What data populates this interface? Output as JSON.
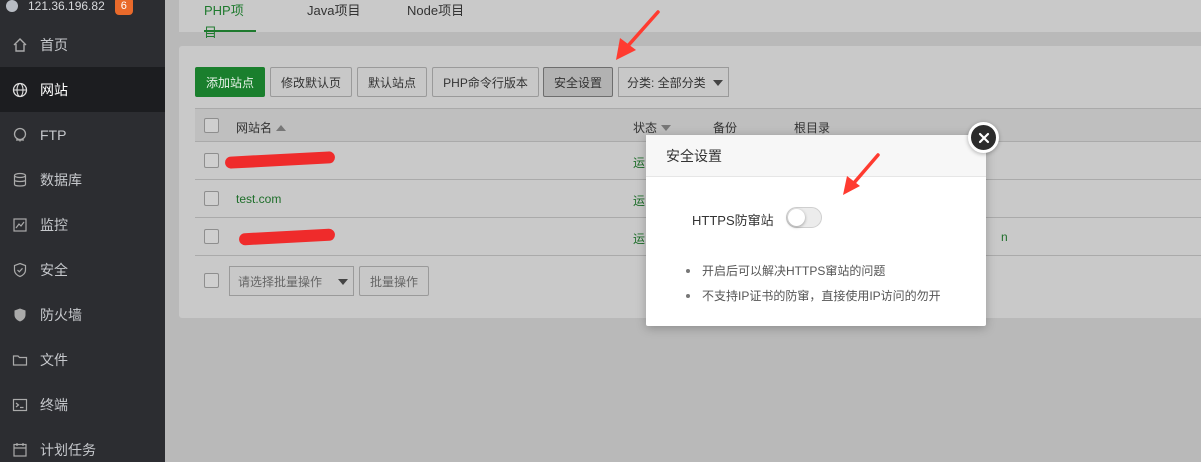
{
  "sidebar": {
    "host": "121.36.196.82",
    "badge": "6",
    "items": [
      {
        "label": "首页",
        "icon": "home-icon"
      },
      {
        "label": "网站",
        "icon": "globe-icon"
      },
      {
        "label": "FTP",
        "icon": "ftp-icon"
      },
      {
        "label": "数据库",
        "icon": "database-icon"
      },
      {
        "label": "监控",
        "icon": "monitor-icon"
      },
      {
        "label": "安全",
        "icon": "shield-icon"
      },
      {
        "label": "防火墙",
        "icon": "firewall-icon"
      },
      {
        "label": "文件",
        "icon": "folder-icon"
      },
      {
        "label": "终端",
        "icon": "terminal-icon"
      },
      {
        "label": "计划任务",
        "icon": "clock-icon"
      }
    ]
  },
  "tabs": [
    "PHP项目",
    "Java项目",
    "Node项目"
  ],
  "toolbar": {
    "add_site": "添加站点",
    "edit_default": "修改默认页",
    "default_site": "默认站点",
    "php_cli": "PHP命令行版本",
    "security": "安全设置",
    "category": "分类: 全部分类"
  },
  "table": {
    "headers": {
      "name": "网站名",
      "status": "状态",
      "backup": "备份",
      "root": "根目录"
    },
    "rows": [
      {
        "name": "",
        "status": "运"
      },
      {
        "name": "test.com",
        "status": "运"
      },
      {
        "name": "",
        "status": "运",
        "root_tail": "n"
      }
    ]
  },
  "batch": {
    "placeholder": "请选择批量操作",
    "button": "批量操作"
  },
  "modal": {
    "title": "安全设置",
    "setting_label": "HTTPS防窜站",
    "toggle_on": false,
    "notes": [
      "开启后可以解决HTTPS窜站的问题",
      "不支持IP证书的防窜，直接使用IP访问的勿开"
    ]
  },
  "colors": {
    "accent": "#20a53a",
    "arrow": "#ff3b30",
    "sidebar_bg": "#2c2d31"
  }
}
